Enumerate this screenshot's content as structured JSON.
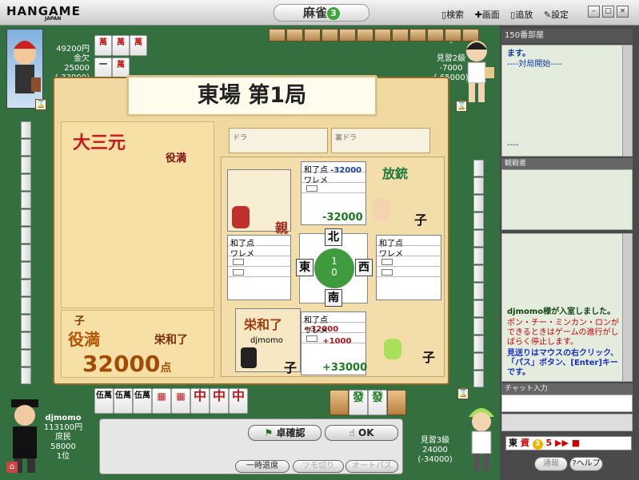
{
  "app": {
    "logo": "HANGAME",
    "logo_sub": "JAPAN",
    "title": "麻雀",
    "title_badge": "3",
    "menu": [
      "検索",
      "画面",
      "追放",
      "設定"
    ],
    "window_buttons": [
      "–",
      "□",
      "×"
    ]
  },
  "players": {
    "top_left": {
      "money": "49200円",
      "rank": "金欠",
      "score": "25000",
      "delta": "(-33000)"
    },
    "top_right": {
      "name": "-",
      "rank": "見習2級",
      "score": "-7000",
      "delta": "(-65000)"
    },
    "bottom_left": {
      "name": "djmomo",
      "money": "113100円",
      "rank": "庶民",
      "score": "58000",
      "place": "1位"
    },
    "bottom_right": {
      "rank": "見習3級",
      "score": "24000",
      "delta": "(-34000)"
    }
  },
  "hand": {
    "tiles": [
      "伍萬",
      "伍萬",
      "伍萬",
      "",
      "",
      "中",
      "中",
      "中"
    ],
    "right_tiles": [
      "發",
      "發"
    ]
  },
  "result": {
    "round": "東場 第1局",
    "yaku": "大三元",
    "yaku_level": "役満",
    "winner_role": "子",
    "rank_word": "役満",
    "win_label": "栄和了",
    "points": "32000",
    "points_unit": "点",
    "dora_label": "ドラ",
    "ura_dora_label": "裏ドラ"
  },
  "board": {
    "north": {
      "head": "和了点",
      "val": "-32000",
      "label": "放銃",
      "row2": "ワレメ",
      "total": "-32000",
      "role": "子"
    },
    "west": {
      "head": "和了点",
      "row2": "ワレメ",
      "role": "親"
    },
    "east": {
      "head": "和了点",
      "row2": "ワレメ"
    },
    "south": {
      "head": "和了点",
      "val": "+32000",
      "row2": "ワレメ",
      "bonus": "+1000",
      "total": "+33000",
      "name": "djmomo",
      "win": "栄和了",
      "role": "子"
    },
    "east_role": "子",
    "dirs": {
      "n": "北",
      "w": "東",
      "e": "西",
      "s": "南"
    },
    "center": [
      "1",
      "0"
    ]
  },
  "buttons": {
    "confirm": "卓確認",
    "ok": "OK",
    "leave": "一時退席",
    "tsumogiri": "ツモ切り",
    "autopass": "オートパス"
  },
  "sidebar": {
    "room": "150番部屋",
    "log_lines": [
      "ます。",
      "----対局開始----",
      "",
      "----"
    ],
    "spectators_label": "観戦者",
    "chat_lines": [
      {
        "text": "djmomo様が入室しました。",
        "color": "#114411"
      },
      {
        "text": "ポン・チー・ミンカン・ロンができるときはゲームの進行がしばらく停止します。",
        "color": "#c40000"
      },
      {
        "text": "見送りはマウスの右クリック、「パス」ボタン、[Enter]キーです。",
        "color": "#1a2ec4"
      }
    ],
    "chat_input_label": "チャット入力",
    "status": [
      "東",
      "3",
      "5"
    ],
    "report": "通報",
    "help": "ヘルプ"
  }
}
